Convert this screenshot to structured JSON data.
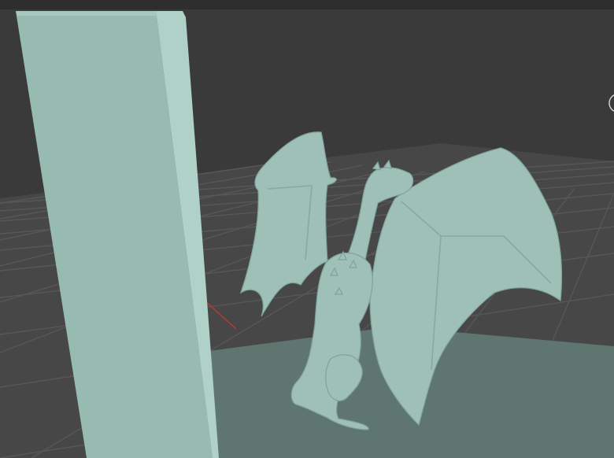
{
  "viewport": {
    "background": "#3a3a3a",
    "header_background": "#2e2e2e",
    "grid_color": "#555555",
    "grid_fill": "#474747",
    "x_axis_color": "#c0392b",
    "object_color": "#9ec0b6",
    "object_shadow": "#7fa39a",
    "ground_plane_color": "#5f7670"
  },
  "objects": [
    {
      "name": "Cube",
      "type": "mesh-box"
    },
    {
      "name": "Dragon",
      "type": "mesh-sculpt"
    },
    {
      "name": "Plane",
      "type": "mesh-plane"
    }
  ],
  "icons": {
    "view_gizmo": "navigation-gizmo-icon"
  }
}
